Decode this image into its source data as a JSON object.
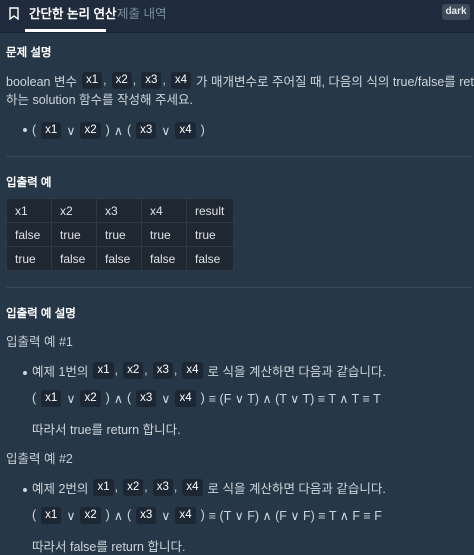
{
  "tabs": {
    "active": "간단한 논리 연산",
    "inactive": "제출 내역"
  },
  "theme_button": "dark",
  "description": {
    "heading": "문제 설명",
    "line1_pre": "boolean 변수",
    "vars": [
      "x1",
      "x2",
      "x3",
      "x4"
    ],
    "comma": ",",
    "line1_post": "가 매개변수로 주어질 때, 다음의 식의 true/false를 return",
    "line2": "하는 solution 함수를 작성해 주세요.",
    "expr": {
      "open": "(",
      "close": ")",
      "or": "∨",
      "and": "∧"
    }
  },
  "io_example": {
    "heading": "입출력 예",
    "columns": [
      "x1",
      "x2",
      "x3",
      "x4",
      "result"
    ],
    "rows": [
      [
        "false",
        "true",
        "true",
        "true",
        "true"
      ],
      [
        "true",
        "false",
        "false",
        "false",
        "false"
      ]
    ]
  },
  "io_explanation": {
    "heading": "입출력 예 설명",
    "examples": [
      {
        "title": "입출력 예 #1",
        "intro_pre": "예제 1번의",
        "intro_post": "로 식을 계산하면 다음과 같습니다.",
        "eval": "≡ (F ∨ T) ∧ (T ∨ T) ≡ T ∧ T ≡ T",
        "conclusion": "따라서 true를 return 합니다."
      },
      {
        "title": "입출력 예 #2",
        "intro_pre": "예제 2번의",
        "intro_post": "로 식을 계산하면 다음과 같습니다.",
        "eval": "≡ (T ∨ F) ∧ (F ∨ F) ≡ T ∧ F ≡ F",
        "conclusion": "따라서 false를 return 합니다."
      }
    ]
  }
}
